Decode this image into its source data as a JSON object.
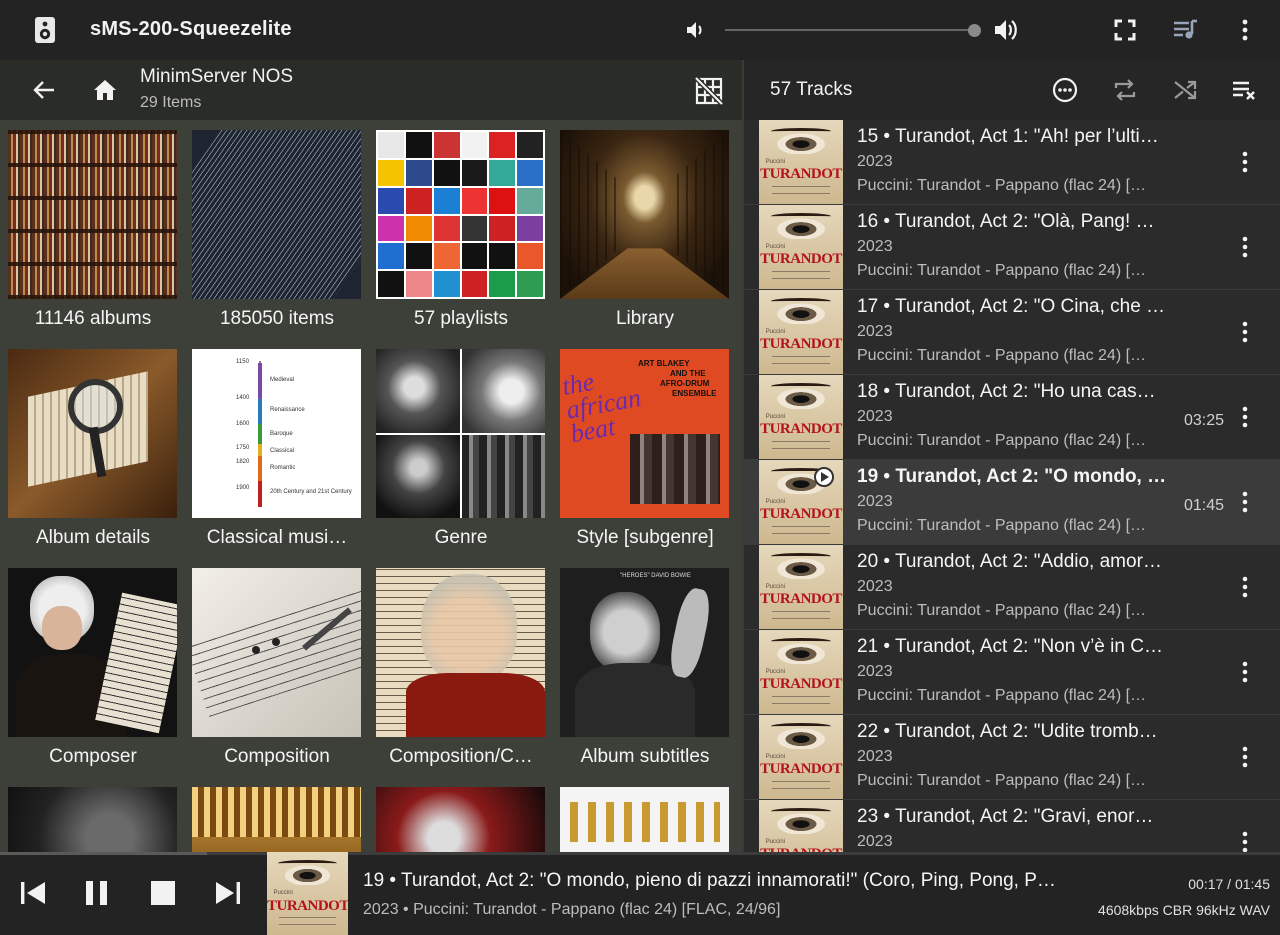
{
  "topbar": {
    "player_name": "sMS-200-Squeezelite",
    "volume_percent": 100
  },
  "browser": {
    "title": "MinimServer NOS",
    "subtitle": "29 Items",
    "tiles": [
      {
        "label": "11146 albums"
      },
      {
        "label": "185050 items"
      },
      {
        "label": "57 playlists"
      },
      {
        "label": "Library"
      },
      {
        "label": "Album details"
      },
      {
        "label": "Classical musi…"
      },
      {
        "label": "Genre"
      },
      {
        "label": "Style [subgenre]"
      },
      {
        "label": "Composer"
      },
      {
        "label": "Composition"
      },
      {
        "label": "Composition/C…"
      },
      {
        "label": "Album subtitles"
      },
      {
        "label": ""
      },
      {
        "label": ""
      },
      {
        "label": ""
      },
      {
        "label": ""
      }
    ],
    "timeline": {
      "years": [
        "1150",
        "1400",
        "1600",
        "1750",
        "1820",
        "1900"
      ],
      "eras": [
        "Medieval",
        "Renaissance",
        "Baroque",
        "Classical",
        "Romantic",
        "20th Century and 21st Century"
      ]
    },
    "album_art_text": {
      "blakey_artist": "ART BLAKEY",
      "blakey_line2": "AND THE",
      "blakey_line3": "AFRO-DRUM",
      "blakey_line4": "ENSEMBLE",
      "blakey_title": "the african beat",
      "bowie_title": "\"HEROES\" DAVID BOWIE"
    }
  },
  "queue": {
    "count_label": "57 Tracks",
    "tracks": [
      {
        "title": "15 • Turandot, Act 1: \"Ah! per l’ulti…",
        "year": "2023",
        "album": "Puccini: Turandot - Pappano (flac 24) […",
        "duration": ""
      },
      {
        "title": "16 • Turandot, Act 2: \"Olà, Pang! O…",
        "year": "2023",
        "album": "Puccini: Turandot - Pappano (flac 24) […",
        "duration": ""
      },
      {
        "title": "17 • Turandot, Act 2: \"O Cina, che …",
        "year": "2023",
        "album": "Puccini: Turandot - Pappano (flac 24) […",
        "duration": ""
      },
      {
        "title": "18 • Turandot, Act 2: \"Ho una cas…",
        "year": "2023",
        "album": "Puccini: Turandot - Pappano (flac 24) […",
        "duration": "03:25"
      },
      {
        "title": "19 • Turandot, Act 2: \"O mondo, p…",
        "year": "2023",
        "album": "Puccini: Turandot - Pappano (flac 24) […",
        "duration": "01:45"
      },
      {
        "title": "20 • Turandot, Act 2: \"Addio, amor…",
        "year": "2023",
        "album": "Puccini: Turandot - Pappano (flac 24) […",
        "duration": ""
      },
      {
        "title": "21 • Turandot, Act 2: \"Non v’è in Ci…",
        "year": "2023",
        "album": "Puccini: Turandot - Pappano (flac 24) […",
        "duration": ""
      },
      {
        "title": "22 • Turandot, Act 2: \"Udite tromb…",
        "year": "2023",
        "album": "Puccini: Turandot - Pappano (flac 24) […",
        "duration": ""
      },
      {
        "title": "23 • Turandot, Act 2: \"Gravi, enor…",
        "year": "2023",
        "album": "",
        "duration": ""
      }
    ],
    "current_index": 4,
    "album_art": {
      "composer": "Puccini",
      "word": "TURANDOT"
    }
  },
  "now_playing": {
    "title": "19 • Turandot, Act 2: \"O mondo, pieno di pazzi innamorati!\" (Coro, Ping, Pong, P…",
    "subtitle": "2023 • Puccini: Turandot - Pappano (flac 24) [FLAC, 24/96]",
    "time": "00:17 / 01:45",
    "format": "4608kbps CBR 96kHz WAV",
    "progress_fraction": 0.162
  },
  "colors": {
    "accent": "#f2f2f2",
    "queue_icon": "#9aa4b8"
  }
}
